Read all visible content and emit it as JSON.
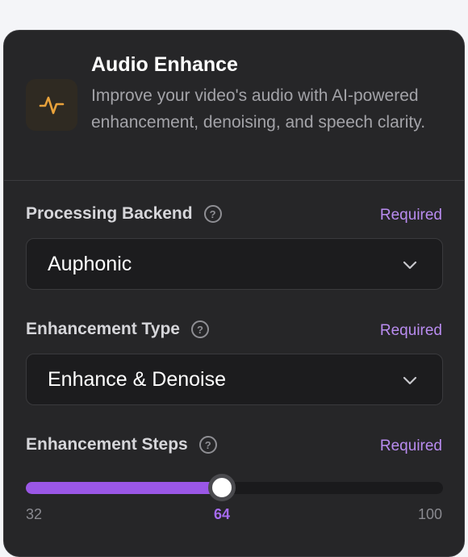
{
  "header": {
    "title": "Audio Enhance",
    "description": "Improve your video's audio with AI-powered enhancement, denoising, and speech clarity.",
    "icon": "waveform-icon",
    "accent": "#e9a23b"
  },
  "fields": {
    "backend": {
      "label": "Processing Backend",
      "required": "Required",
      "value": "Auphonic"
    },
    "type": {
      "label": "Enhancement Type",
      "required": "Required",
      "value": "Enhance & Denoise"
    },
    "steps": {
      "label": "Enhancement Steps",
      "required": "Required",
      "min": "32",
      "current": "64",
      "max": "100",
      "value_fraction": 0.47
    }
  },
  "colors": {
    "required": "#b98cf0",
    "slider_fill": "#9a57e6"
  }
}
